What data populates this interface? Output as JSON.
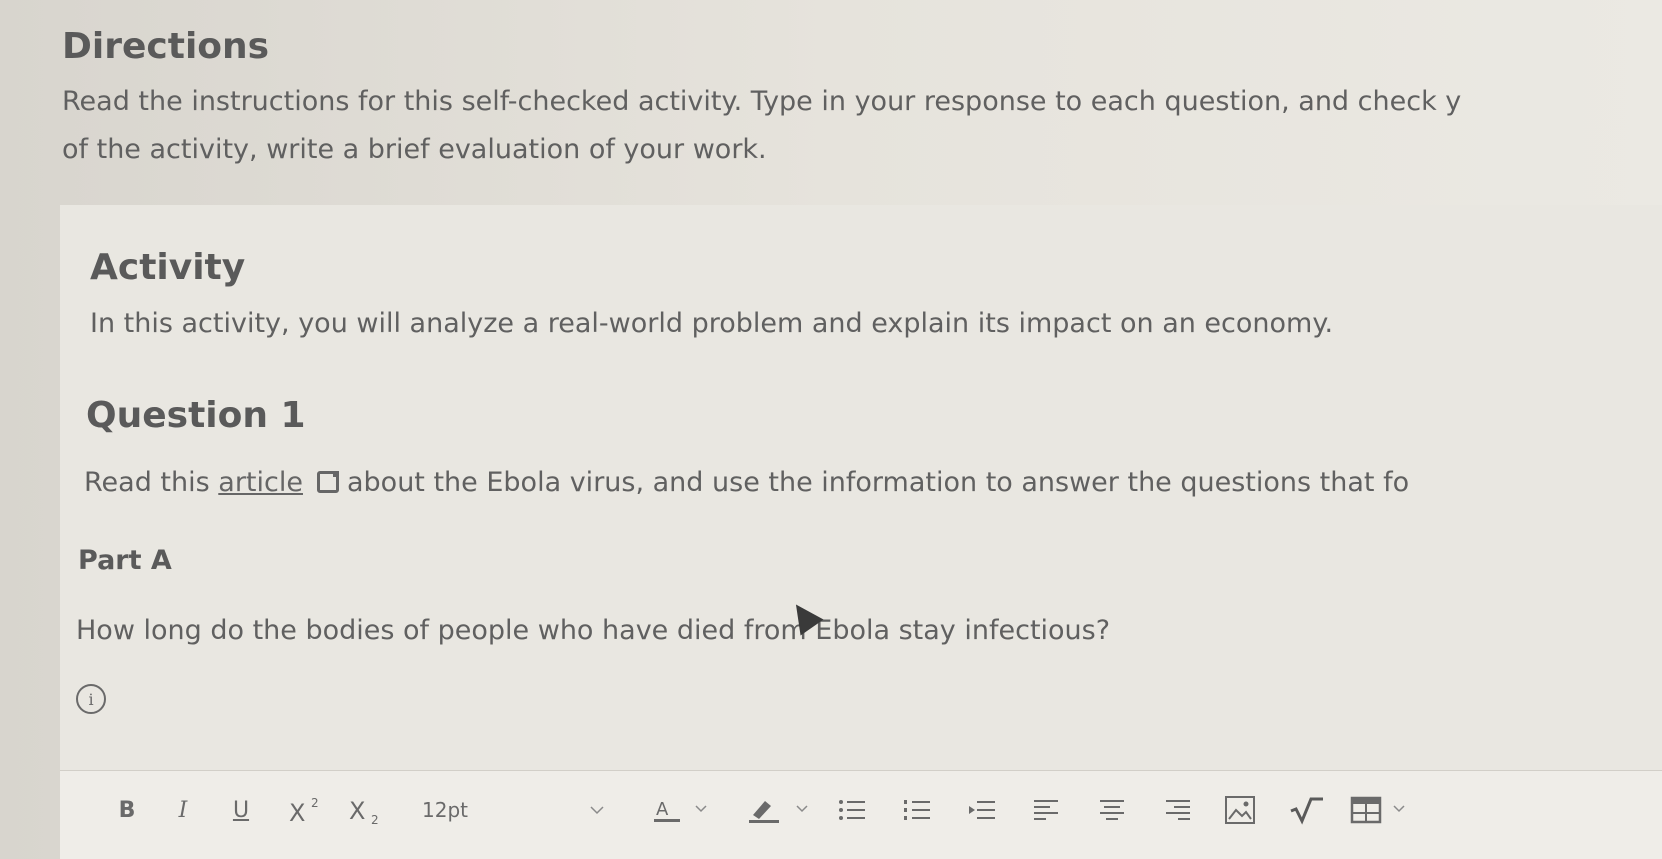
{
  "directions": {
    "title": "Directions",
    "line1": "Read the instructions for this self-checked activity. Type in your response to each question, and check y",
    "line2": "of the activity, write a brief evaluation of your work."
  },
  "activity": {
    "title": "Activity",
    "text": "In this activity, you will analyze a real-world problem and explain its impact on an economy."
  },
  "question": {
    "title": "Question 1",
    "text_before": "Read this ",
    "link_text": "article",
    "text_after": "about the Ebola virus, and use the information to answer the questions that fo"
  },
  "part": {
    "title": "Part A",
    "text": "How long do the bodies of people who have died from Ebola stay infectious?"
  },
  "toolbar": {
    "bold": "B",
    "italic": "I",
    "underline": "U",
    "font_size": "12pt"
  }
}
